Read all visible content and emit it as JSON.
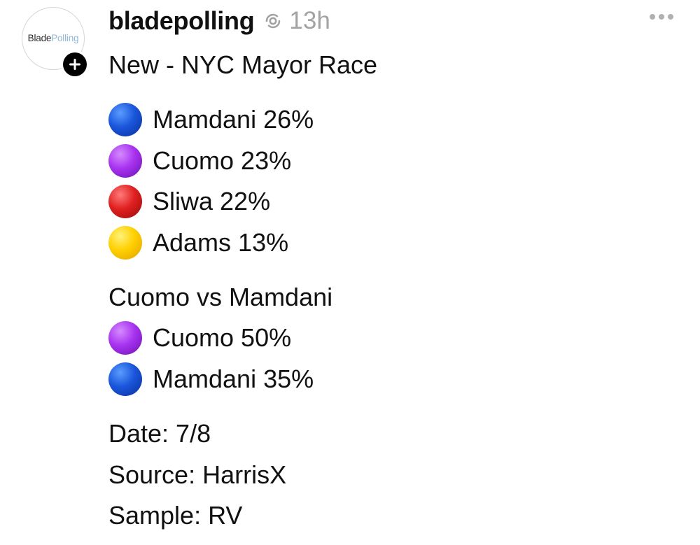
{
  "post": {
    "username": "bladepolling",
    "time": "13h",
    "avatar_logo": {
      "part1": "Blade",
      "part2": "Polling"
    },
    "icons": {
      "repost": "repost-icon",
      "more": "more-options-icon",
      "follow": "plus-icon"
    },
    "title": "New - NYC Mayor Race",
    "poll_results": [
      {
        "candidate": "Mamdani 26%",
        "color_name": "blue",
        "color": "#1a56db"
      },
      {
        "candidate": "Cuomo 23%",
        "color_name": "purple",
        "color": "#a833f0"
      },
      {
        "candidate": "Sliwa 22%",
        "color_name": "red",
        "color": "#e02020"
      },
      {
        "candidate": "Adams 13%",
        "color_name": "yellow",
        "color": "#ffcc00"
      }
    ],
    "head_to_head_title": "Cuomo vs Mamdani",
    "head_to_head": [
      {
        "candidate": "Cuomo 50%",
        "color_name": "purple",
        "color": "#a833f0"
      },
      {
        "candidate": "Mamdani 35%",
        "color_name": "blue",
        "color": "#1a56db"
      }
    ],
    "date": "Date: 7/8",
    "source": "Source: HarrisX",
    "sample": "Sample: RV"
  }
}
